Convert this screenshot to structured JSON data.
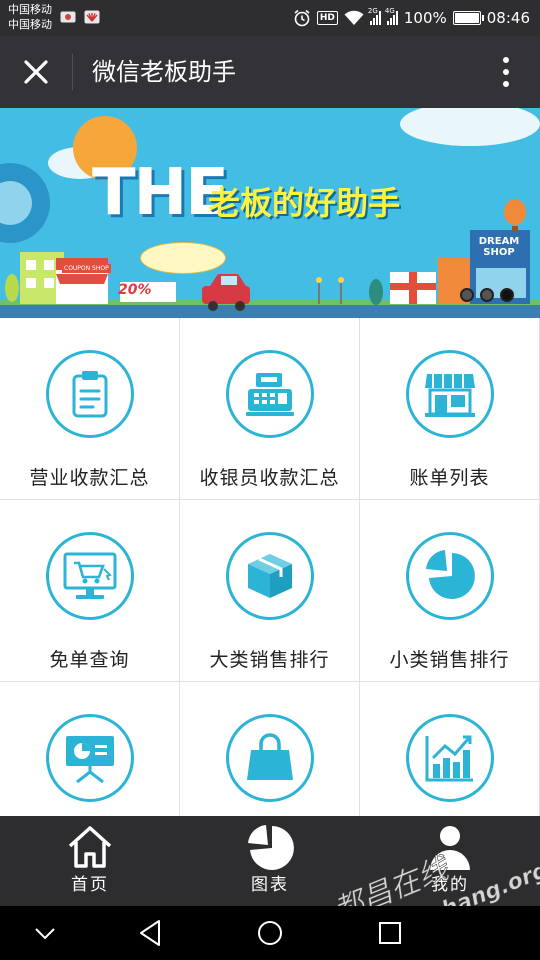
{
  "status_bar": {
    "carrier_1": "中国移动",
    "carrier_2": "中国移动",
    "hd": "HD",
    "net_1": "2G",
    "net_2": "4G",
    "battery": "100%",
    "time": "08:46"
  },
  "app_bar": {
    "title": "微信老板助手",
    "close_icon": "close-icon",
    "more_icon": "more-vertical-icon"
  },
  "banner": {
    "headline": "THE",
    "subtitle": "老板的好助手",
    "percent": "20%",
    "shop_sign": "DREAM SHOP",
    "coupon_sign": "COUPON SHOP",
    "slide_count": 3,
    "active_slide": 3
  },
  "grid": {
    "items": [
      {
        "label": "营业收款汇总",
        "icon": "clipboard-icon"
      },
      {
        "label": "收银员收款汇总",
        "icon": "cash-register-icon"
      },
      {
        "label": "账单列表",
        "icon": "storefront-icon"
      },
      {
        "label": "免单查询",
        "icon": "monitor-cart-icon"
      },
      {
        "label": "大类销售排行",
        "icon": "box-icon"
      },
      {
        "label": "小类销售排行",
        "icon": "pie-chart-icon"
      },
      {
        "label": "",
        "icon": "presentation-board-icon"
      },
      {
        "label": "",
        "icon": "shopping-bag-icon"
      },
      {
        "label": "",
        "icon": "bar-chart-up-icon"
      }
    ]
  },
  "bottom_nav": {
    "items": [
      {
        "label": "首页",
        "icon": "home-icon"
      },
      {
        "label": "图表",
        "icon": "pie-chart-icon"
      },
      {
        "label": "我的",
        "icon": "user-icon"
      }
    ]
  },
  "watermark": {
    "line_1": "都昌在线",
    "line_2": "www.duchang.org"
  },
  "colors": {
    "accent": "#2cb4d6",
    "appbar": "#333337",
    "banner_bg": "#44bde5",
    "bottom_nav": "#2d2d2f"
  }
}
